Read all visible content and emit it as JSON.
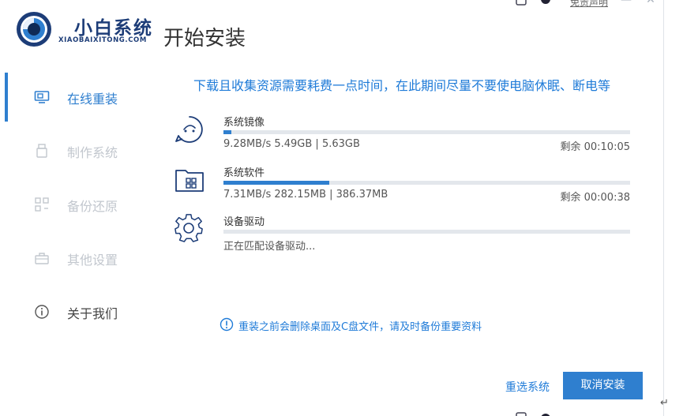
{
  "app": {
    "name": "小白系统",
    "subtitle": "XIAOBAIXITONG.COM"
  },
  "page_title": "开始安装",
  "topbar": {
    "disclaimer": "免责声明"
  },
  "sidebar": {
    "items": [
      {
        "label": "在线重装",
        "icon": "monitor-icon",
        "active": true
      },
      {
        "label": "制作系统",
        "icon": "usb-icon",
        "active": false
      },
      {
        "label": "备份还原",
        "icon": "backup-icon",
        "active": false
      },
      {
        "label": "其他设置",
        "icon": "briefcase-icon",
        "active": false
      },
      {
        "label": "关于我们",
        "icon": "info-icon",
        "active": false
      }
    ]
  },
  "notice": "下载且收集资源需要耗费一点时间，在此期间尽量不要使电脑休眠、断电等",
  "tasks": [
    {
      "name": "系统镜像",
      "icon": "disc-icon",
      "stats": "9.28MB/s 5.49GB | 5.63GB",
      "remaining": "剩余 00:10:05",
      "progress": 0.02
    },
    {
      "name": "系统软件",
      "icon": "folder-apps-icon",
      "stats": "7.31MB/s 282.15MB | 386.37MB",
      "remaining": "剩余 00:00:38",
      "progress": 0.26
    },
    {
      "name": "设备驱动",
      "icon": "gear-icon",
      "stats": "正在匹配设备驱动...",
      "remaining": "",
      "progress": 0
    }
  ],
  "warning": "重装之前会删除桌面及C盘文件，请及时备份重要资料",
  "buttons": {
    "reselect": "重选系统",
    "cancel": "取消安装"
  },
  "colors": {
    "accent": "#2f7fcf",
    "link": "#1f7bd8",
    "inactive": "#c2c7ce",
    "brand": "#1d3d78"
  }
}
